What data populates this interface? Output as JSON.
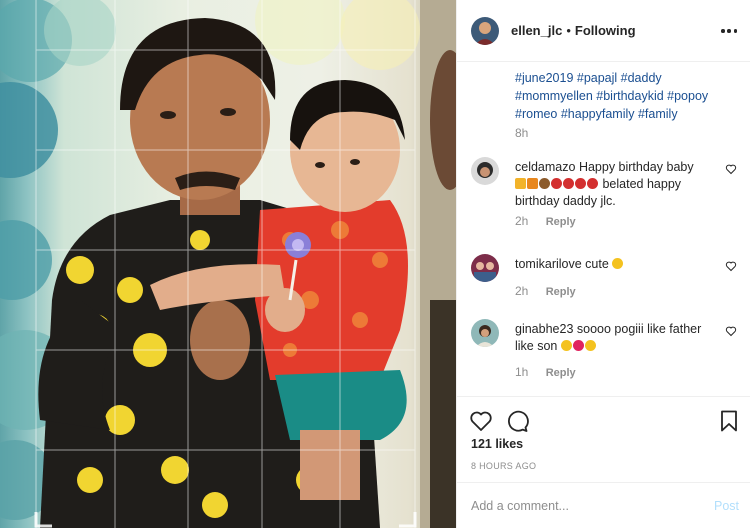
{
  "post": {
    "image_alt_icon": "post-photo",
    "username": "ellen_jlc",
    "separator": "•",
    "follow_status": "Following",
    "more_icon": "more-horizontal-icon"
  },
  "caption": {
    "hashtags_line1": "#june2019 #papajl #daddy",
    "hashtags_line2": "#mommyellen #birthdaykid #popoy",
    "hashtags_line3": "#romeo #happyfamily #family",
    "time": "8h"
  },
  "comments": [
    {
      "username": "celdamazo",
      "text_before": "Happy birthday baby",
      "text_after": "belated happy birthday daddy jlc.",
      "time": "2h",
      "reply_label": "Reply"
    },
    {
      "username": "tomikarilove",
      "text_before": "cute",
      "text_after": "",
      "time": "2h",
      "reply_label": "Reply"
    },
    {
      "username": "ginabhe23",
      "text_before": "soooo pogiii like father like son",
      "text_after": "",
      "time": "1h",
      "reply_label": "Reply"
    }
  ],
  "footer": {
    "likes": "121 likes",
    "timestamp": "8 HOURS AGO",
    "comment_placeholder": "Add a comment...",
    "post_label": "Post"
  },
  "colors": {
    "hashtag": "#1b4f91",
    "muted": "#8e8e8e",
    "post_button": "#b2dffc",
    "text": "#262626"
  }
}
